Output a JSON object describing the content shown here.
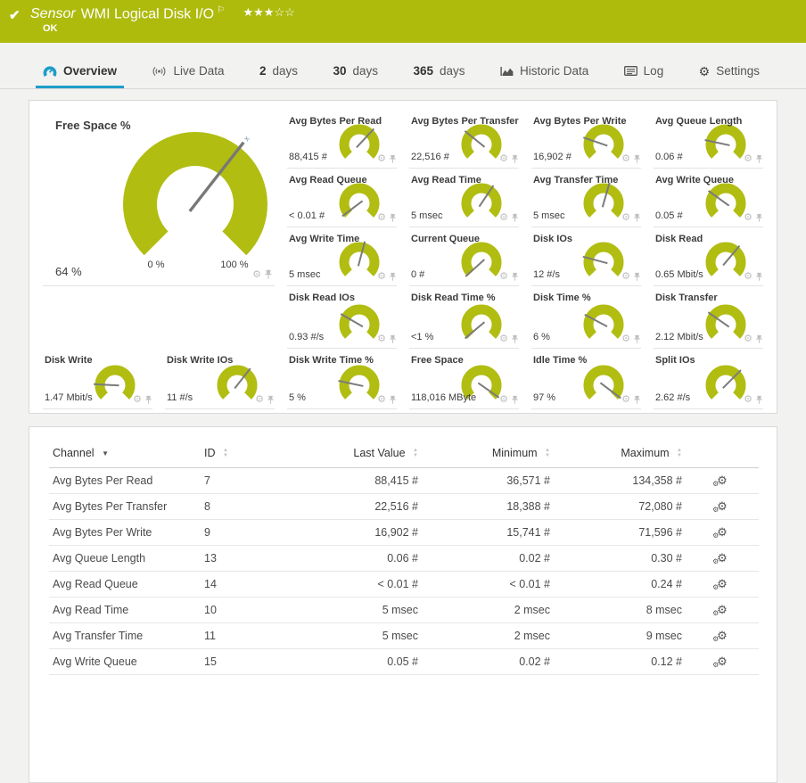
{
  "colors": {
    "header_green": "#aebb0d",
    "gauge_green": "#b1bd11",
    "active_tab_blue": "#1d9dc9"
  },
  "header": {
    "status_icon": "✔",
    "kind": "Sensor",
    "title": "WMI Logical Disk I/O",
    "flag_icon": "⚐",
    "rating_filled": "★★★",
    "rating_empty": "☆☆",
    "status": "OK"
  },
  "tabs": {
    "overview": {
      "label": "Overview",
      "icon": "gauge-icon",
      "active": true
    },
    "live_data": {
      "label": "Live Data",
      "icon": "broadcast-icon"
    },
    "days2": {
      "num": "2",
      "label": "days"
    },
    "days30": {
      "num": "30",
      "label": "days"
    },
    "days365": {
      "num": "365",
      "label": "days"
    },
    "historic": {
      "label": "Historic Data",
      "icon": "area-chart-icon"
    },
    "log": {
      "label": "Log",
      "icon": "log-icon"
    },
    "settings": {
      "label": "Settings",
      "icon": "gear-icon"
    }
  },
  "big_gauge": {
    "label": "Free Space %",
    "value": "64 %",
    "scale_min": "0 %",
    "scale_max": "100 %",
    "needle_angle": 308
  },
  "gauges": [
    {
      "label": "Avg Bytes Per Read",
      "value": "88,415 #",
      "needle_angle": 313
    },
    {
      "label": "Avg Bytes Per Transfer",
      "value": "22,516 #",
      "needle_angle": 219
    },
    {
      "label": "Avg Bytes Per Write",
      "value": "16,902 #",
      "needle_angle": 199
    },
    {
      "label": "Avg Queue Length",
      "value": "0.06 #",
      "needle_angle": 192
    },
    {
      "label": "Avg Read Queue",
      "value": "< 0.01 #",
      "needle_angle": 143
    },
    {
      "label": "Avg Read Time",
      "value": "5 msec",
      "needle_angle": 304
    },
    {
      "label": "Avg Transfer Time",
      "value": "5 msec",
      "needle_angle": 286
    },
    {
      "label": "Avg Write Queue",
      "value": "0.05 #",
      "needle_angle": 216
    },
    {
      "label": "Avg Write Time",
      "value": "5 msec",
      "needle_angle": 285
    },
    {
      "label": "Current Queue",
      "value": "0 #",
      "needle_angle": 138
    },
    {
      "label": "Disk IOs",
      "value": "12 #/s",
      "needle_angle": 195
    },
    {
      "label": "Disk Read",
      "value": "0.65 Mbit/s",
      "needle_angle": 310
    },
    {
      "label": "Disk Read IOs",
      "value": "0.93 #/s",
      "needle_angle": 210
    },
    {
      "label": "Disk Read Time %",
      "value": "<1 %",
      "needle_angle": 140
    },
    {
      "label": "Disk Time %",
      "value": "6 %",
      "needle_angle": 208
    },
    {
      "label": "Disk Transfer",
      "value": "2.12 Mbit/s",
      "needle_angle": 215
    },
    {
      "label": "Disk Write",
      "value": "1.47 Mbit/s",
      "needle_angle": 183
    },
    {
      "label": "Disk Write IOs",
      "value": "11 #/s",
      "needle_angle": 308
    },
    {
      "label": "Disk Write Time %",
      "value": "5 %",
      "needle_angle": 192
    },
    {
      "label": "Free Space",
      "value": "118,016 MByte",
      "needle_angle": 35
    },
    {
      "label": "Idle Time %",
      "value": "97 %",
      "needle_angle": 37
    },
    {
      "label": "Split IOs",
      "value": "2.62 #/s",
      "needle_angle": 315
    }
  ],
  "table": {
    "columns": {
      "channel": {
        "label": "Channel",
        "sort": "desc"
      },
      "id": {
        "label": "ID"
      },
      "last_value": {
        "label": "Last Value"
      },
      "minimum": {
        "label": "Minimum"
      },
      "maximum": {
        "label": "Maximum"
      }
    },
    "rows": [
      {
        "channel": "Avg Bytes Per Read",
        "id": "7",
        "last_value": "88,415 #",
        "minimum": "36,571 #",
        "maximum": "134,358 #"
      },
      {
        "channel": "Avg Bytes Per Transfer",
        "id": "8",
        "last_value": "22,516 #",
        "minimum": "18,388 #",
        "maximum": "72,080 #"
      },
      {
        "channel": "Avg Bytes Per Write",
        "id": "9",
        "last_value": "16,902 #",
        "minimum": "15,741 #",
        "maximum": "71,596 #"
      },
      {
        "channel": "Avg Queue Length",
        "id": "13",
        "last_value": "0.06 #",
        "minimum": "0.02 #",
        "maximum": "0.30 #"
      },
      {
        "channel": "Avg Read Queue",
        "id": "14",
        "last_value": "< 0.01 #",
        "minimum": "< 0.01 #",
        "maximum": "0.24 #"
      },
      {
        "channel": "Avg Read Time",
        "id": "10",
        "last_value": "5 msec",
        "minimum": "2 msec",
        "maximum": "8 msec"
      },
      {
        "channel": "Avg Transfer Time",
        "id": "11",
        "last_value": "5 msec",
        "minimum": "2 msec",
        "maximum": "9 msec"
      },
      {
        "channel": "Avg Write Queue",
        "id": "15",
        "last_value": "0.05 #",
        "minimum": "0.02 #",
        "maximum": "0.12 #"
      }
    ]
  }
}
